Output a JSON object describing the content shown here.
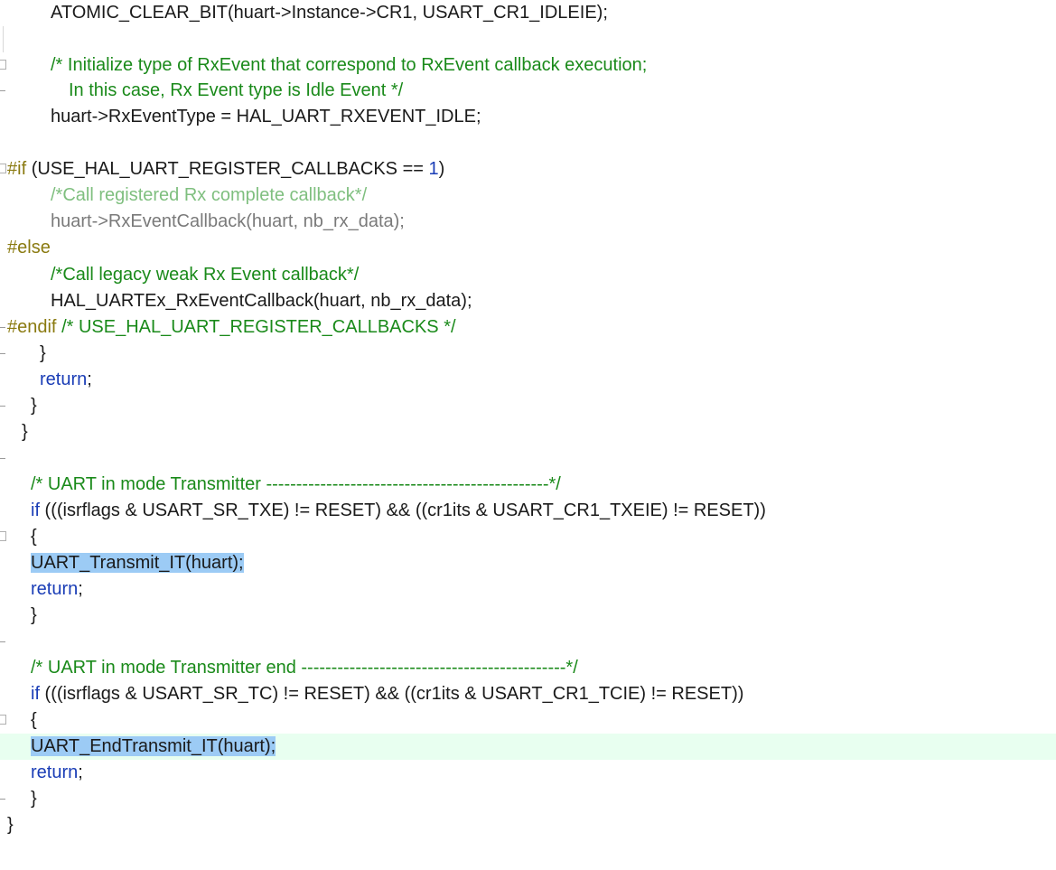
{
  "editor": {
    "lines": [
      {
        "gutter": "none",
        "segments": [
          {
            "t": "ATOMIC_CLEAR_BIT(huart->Instance->CR1, USART_CR1_IDLEIE);",
            "c": "id"
          }
        ]
      },
      {
        "gutter": "vline",
        "segments": []
      },
      {
        "gutter": "fold",
        "segments": [
          {
            "t": "/* Initialize type of RxEvent that correspond to RxEvent callback execution;",
            "c": "cm"
          }
        ]
      },
      {
        "gutter": "tick",
        "segments": [
          {
            "t": "In this case, Rx Event type is Idle Event */",
            "c": "cm"
          }
        ]
      },
      {
        "gutter": "none",
        "segments": [
          {
            "t": "huart->RxEventType = HAL_UART_RXEVENT_IDLE;",
            "c": "id"
          }
        ]
      },
      {
        "gutter": "none",
        "segments": []
      },
      {
        "gutter": "fold",
        "segments": [
          {
            "t": "#if ",
            "c": "pp"
          },
          {
            "t": "(USE_HAL_UART_REGISTER_CALLBACKS == ",
            "c": "id"
          },
          {
            "t": "1",
            "c": "num"
          },
          {
            "t": ")",
            "c": "id"
          }
        ]
      },
      {
        "gutter": "none",
        "segments": [
          {
            "t": "/*Call registered Rx complete callback*/",
            "c": "gcm"
          }
        ]
      },
      {
        "gutter": "none",
        "segments": [
          {
            "t": "huart->RxEventCallback(huart, nb_rx_data);",
            "c": "gr"
          }
        ]
      },
      {
        "gutter": "none",
        "segments": [
          {
            "t": "#else",
            "c": "pp"
          }
        ]
      },
      {
        "gutter": "none",
        "segments": [
          {
            "t": "/*Call legacy weak Rx Event callback*/",
            "c": "cm"
          }
        ]
      },
      {
        "gutter": "none",
        "segments": [
          {
            "t": "HAL_UARTEx_RxEventCallback(huart, nb_rx_data);",
            "c": "id"
          }
        ]
      },
      {
        "gutter": "tick",
        "segments": [
          {
            "t": "#endif ",
            "c": "pp"
          },
          {
            "t": "/* USE_HAL_UART_REGISTER_CALLBACKS */",
            "c": "cm"
          }
        ]
      },
      {
        "gutter": "tick",
        "segments": [
          {
            "t": "}",
            "c": "id"
          }
        ]
      },
      {
        "gutter": "none",
        "segments": [
          {
            "t": "return",
            "c": "kw"
          },
          {
            "t": ";",
            "c": "id"
          }
        ]
      },
      {
        "gutter": "tick",
        "segments": [
          {
            "t": "}",
            "c": "id"
          }
        ]
      },
      {
        "gutter": "none",
        "segments": [
          {
            "t": "}",
            "c": "id"
          }
        ]
      },
      {
        "gutter": "tick",
        "segments": []
      },
      {
        "gutter": "none",
        "segments": [
          {
            "t": "/* UART in mode Transmitter -----------------------------------------------*/",
            "c": "cm"
          }
        ]
      },
      {
        "gutter": "none",
        "segments": [
          {
            "t": "if",
            "c": "kw"
          },
          {
            "t": " (((isrflags & USART_SR_TXE) != RESET) && ((cr1its & USART_CR1_TXEIE) != RESET))",
            "c": "id"
          }
        ]
      },
      {
        "gutter": "fold",
        "segments": [
          {
            "t": "{",
            "c": "id"
          }
        ]
      },
      {
        "gutter": "none",
        "segments": [
          {
            "t": "UART_Transmit_IT(huart);",
            "c": "sel"
          }
        ]
      },
      {
        "gutter": "none",
        "segments": [
          {
            "t": "return",
            "c": "kw"
          },
          {
            "t": ";",
            "c": "id"
          }
        ]
      },
      {
        "gutter": "none",
        "segments": [
          {
            "t": "}",
            "c": "id"
          }
        ]
      },
      {
        "gutter": "tick",
        "segments": []
      },
      {
        "gutter": "none",
        "segments": [
          {
            "t": "/* UART in mode Transmitter end --------------------------------------------*/",
            "c": "cm"
          }
        ]
      },
      {
        "gutter": "none",
        "segments": [
          {
            "t": "if",
            "c": "kw"
          },
          {
            "t": " (((isrflags & USART_SR_TC) != RESET) && ((cr1its & USART_CR1_TCIE) != RESET))",
            "c": "id"
          }
        ]
      },
      {
        "gutter": "fold",
        "segments": [
          {
            "t": "{",
            "c": "id"
          }
        ]
      },
      {
        "gutter": "none",
        "segments": [
          {
            "t": "UART_EndTransmit_IT(huart);",
            "c": "sel"
          }
        ]
      },
      {
        "gutter": "none",
        "segments": [
          {
            "t": "return",
            "c": "kw"
          },
          {
            "t": ";",
            "c": "id"
          }
        ]
      },
      {
        "gutter": "tick",
        "segments": [
          {
            "t": "}",
            "c": "id"
          }
        ]
      },
      {
        "gutter": "none",
        "segments": [
          {
            "t": "}",
            "c": "id"
          }
        ]
      }
    ]
  }
}
